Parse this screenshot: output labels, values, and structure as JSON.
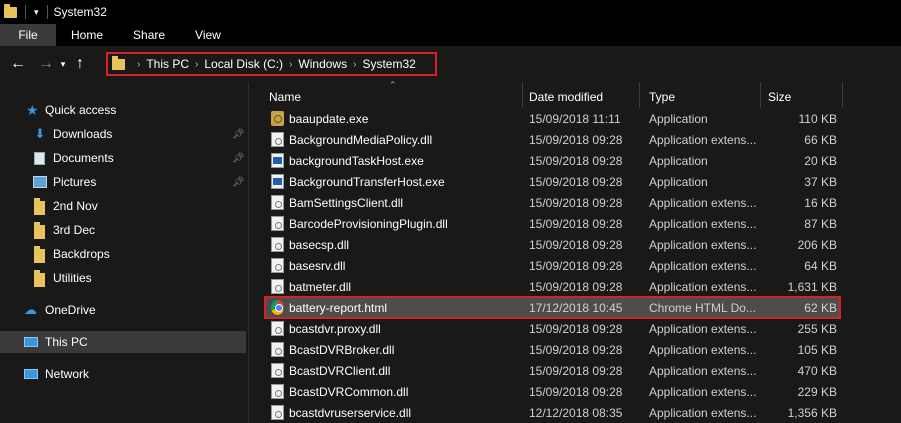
{
  "window": {
    "title": "System32"
  },
  "ribbon": {
    "tabs": [
      "File",
      "Home",
      "Share",
      "View"
    ]
  },
  "address": {
    "crumbs": [
      "This PC",
      "Local Disk (C:)",
      "Windows",
      "System32"
    ]
  },
  "sidebar": {
    "quick_access": "Quick access",
    "items": [
      {
        "label": "Downloads",
        "icon": "download-icon",
        "pinned": true
      },
      {
        "label": "Documents",
        "icon": "documents-icon",
        "pinned": true
      },
      {
        "label": "Pictures",
        "icon": "pictures-icon",
        "pinned": true
      },
      {
        "label": "2nd Nov",
        "icon": "folder-icon",
        "pinned": false
      },
      {
        "label": "3rd Dec",
        "icon": "folder-icon",
        "pinned": false
      },
      {
        "label": "Backdrops",
        "icon": "folder-icon",
        "pinned": false
      },
      {
        "label": "Utilities",
        "icon": "folder-icon",
        "pinned": false
      }
    ],
    "onedrive": "OneDrive",
    "this_pc": "This PC",
    "network": "Network"
  },
  "columns": {
    "name": "Name",
    "date": "Date modified",
    "type": "Type",
    "size": "Size"
  },
  "files": [
    {
      "name": "baaupdate.exe",
      "date": "15/09/2018 11:11",
      "type": "Application",
      "size": "110 KB",
      "icon": "setup-icon"
    },
    {
      "name": "BackgroundMediaPolicy.dll",
      "date": "15/09/2018 09:28",
      "type": "Application extens...",
      "size": "66 KB",
      "icon": "dll-icon"
    },
    {
      "name": "backgroundTaskHost.exe",
      "date": "15/09/2018 09:28",
      "type": "Application",
      "size": "20 KB",
      "icon": "exe-icon"
    },
    {
      "name": "BackgroundTransferHost.exe",
      "date": "15/09/2018 09:28",
      "type": "Application",
      "size": "37 KB",
      "icon": "exe-icon"
    },
    {
      "name": "BamSettingsClient.dll",
      "date": "15/09/2018 09:28",
      "type": "Application extens...",
      "size": "16 KB",
      "icon": "dll-icon"
    },
    {
      "name": "BarcodeProvisioningPlugin.dll",
      "date": "15/09/2018 09:28",
      "type": "Application extens...",
      "size": "87 KB",
      "icon": "dll-icon"
    },
    {
      "name": "basecsp.dll",
      "date": "15/09/2018 09:28",
      "type": "Application extens...",
      "size": "206 KB",
      "icon": "dll-icon"
    },
    {
      "name": "basesrv.dll",
      "date": "15/09/2018 09:28",
      "type": "Application extens...",
      "size": "64 KB",
      "icon": "dll-icon"
    },
    {
      "name": "batmeter.dll",
      "date": "15/09/2018 09:28",
      "type": "Application extens...",
      "size": "1,631 KB",
      "icon": "dll-icon"
    },
    {
      "name": "battery-report.html",
      "date": "17/12/2018 10:45",
      "type": "Chrome HTML Do...",
      "size": "62 KB",
      "icon": "chrome-icon",
      "highlight": true
    },
    {
      "name": "bcastdvr.proxy.dll",
      "date": "15/09/2018 09:28",
      "type": "Application extens...",
      "size": "255 KB",
      "icon": "dll-icon"
    },
    {
      "name": "BcastDVRBroker.dll",
      "date": "15/09/2018 09:28",
      "type": "Application extens...",
      "size": "105 KB",
      "icon": "dll-icon"
    },
    {
      "name": "BcastDVRClient.dll",
      "date": "15/09/2018 09:28",
      "type": "Application extens...",
      "size": "470 KB",
      "icon": "dll-icon"
    },
    {
      "name": "BcastDVRCommon.dll",
      "date": "15/09/2018 09:28",
      "type": "Application extens...",
      "size": "229 KB",
      "icon": "dll-icon"
    },
    {
      "name": "bcastdvruserservice.dll",
      "date": "12/12/2018 08:35",
      "type": "Application extens...",
      "size": "1,356 KB",
      "icon": "dll-icon"
    }
  ]
}
